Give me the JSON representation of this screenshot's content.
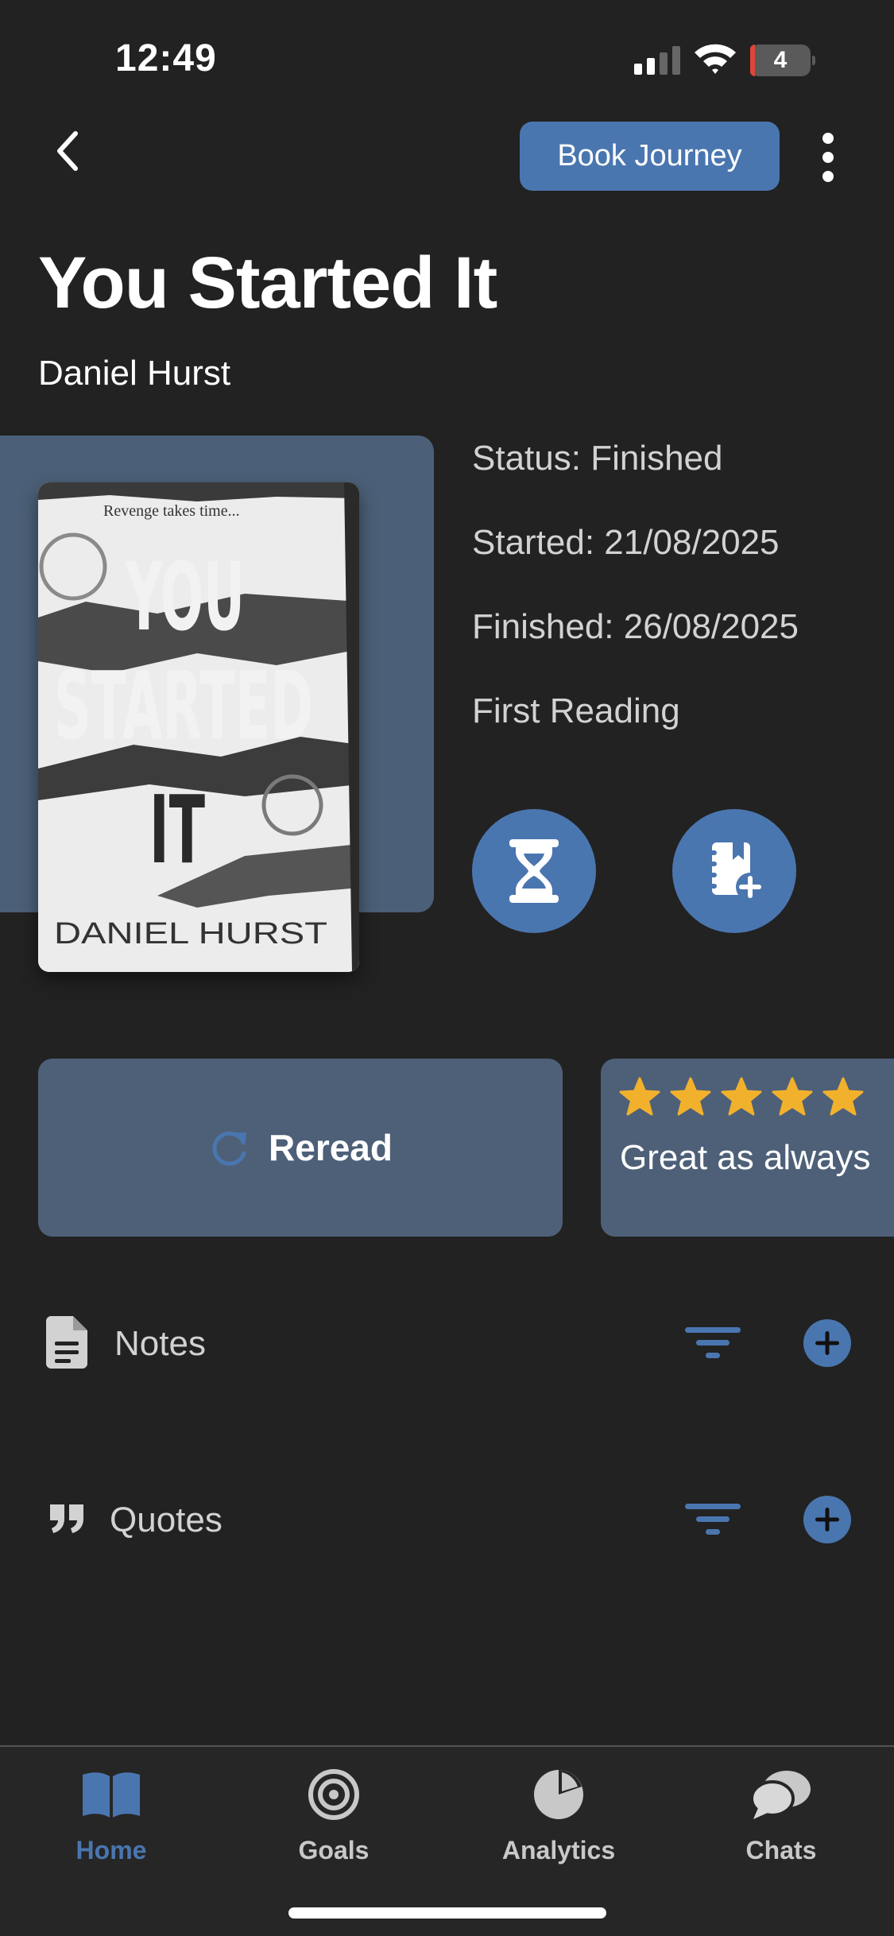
{
  "status_bar": {
    "time": "12:49",
    "battery": "4"
  },
  "header": {
    "journey_button": "Book Journey"
  },
  "book": {
    "title": "You Started It",
    "author": "Daniel Hurst",
    "cover": {
      "tagline": "Revenge takes time...",
      "line1": "YOU",
      "line2": "STARTED",
      "line3": "IT",
      "author": "DANIEL HURST"
    }
  },
  "info": {
    "status": "Status: Finished",
    "started": "Started: 21/08/2025",
    "finished": "Finished: 26/08/2025",
    "reading": "First Reading"
  },
  "reread": {
    "label": "Reread"
  },
  "review": {
    "rating": 5,
    "max_rating": 5,
    "text": "Great as always"
  },
  "sections": {
    "notes": {
      "label": "Notes"
    },
    "quotes": {
      "label": "Quotes"
    }
  },
  "tabbar": {
    "items": [
      {
        "label": "Home",
        "icon": "book-open-icon",
        "active": true
      },
      {
        "label": "Goals",
        "icon": "target-icon",
        "active": false
      },
      {
        "label": "Analytics",
        "icon": "pie-chart-icon",
        "active": false
      },
      {
        "label": "Chats",
        "icon": "chat-bubbles-icon",
        "active": false
      }
    ]
  },
  "colors": {
    "background": "#222222",
    "accent": "#4a76b0",
    "card": "#4e6078",
    "star": "#f2b12c"
  }
}
